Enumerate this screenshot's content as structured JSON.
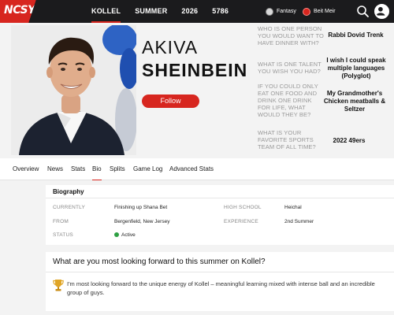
{
  "nav": {
    "logo": "NCSY",
    "links": [
      "KOLLEL",
      "SUMMER",
      "2026",
      "5786"
    ],
    "team1": "Fantasy",
    "team2": "Beit Meir"
  },
  "player": {
    "first_name": "AKIVA",
    "last_name": "SHEINBEIN",
    "follow_label": "Follow"
  },
  "qa": [
    {
      "question": "WHO IS ONE PERSON YOU WOULD WANT TO HAVE DINNER WITH?",
      "answer": "Rabbi Dovid Trenk"
    },
    {
      "question": "WHAT IS ONE TALENT YOU WISH YOU HAD?",
      "answer": "I wish I could speak multiple languages (Polyglot)"
    },
    {
      "question": "IF YOU COULD ONLY EAT ONE FOOD AND DRINK ONE DRINK FOR LIFE, WHAT WOULD THEY BE?",
      "answer": "My Grandmother's Chicken meatballs & Seltzer"
    },
    {
      "question": "WHAT IS YOUR FAVORITE SPORTS TEAM OF ALL TIME?",
      "answer": "2022 49ers"
    }
  ],
  "tabs": [
    "Overview",
    "News",
    "Stats",
    "Bio",
    "Splits",
    "Game Log",
    "Advanced Stats"
  ],
  "biography": {
    "title": "Biography",
    "currently_label": "CURRENTLY",
    "currently_value": "Finishing up Shana Bet",
    "from_label": "FROM",
    "from_value": "Bergenfield, New Jersey",
    "status_label": "STATUS",
    "status_value": "Active",
    "high_school_label": "HIGH SCHOOL",
    "high_school_value": "Heichal",
    "experience_label": "EXPERIENCE",
    "experience_value": "2nd Summer"
  },
  "question_card": {
    "title": "What are you most looking forward to this summer on Kollel?",
    "answer": "I'm most looking forward to the unique energy of Kollel – meaningful learning mixed with intense ball and an incredible group of guys."
  },
  "colors": {
    "accent": "#d7261f",
    "nav_bg": "#1b1b1d",
    "status_active": "#2ea043"
  }
}
